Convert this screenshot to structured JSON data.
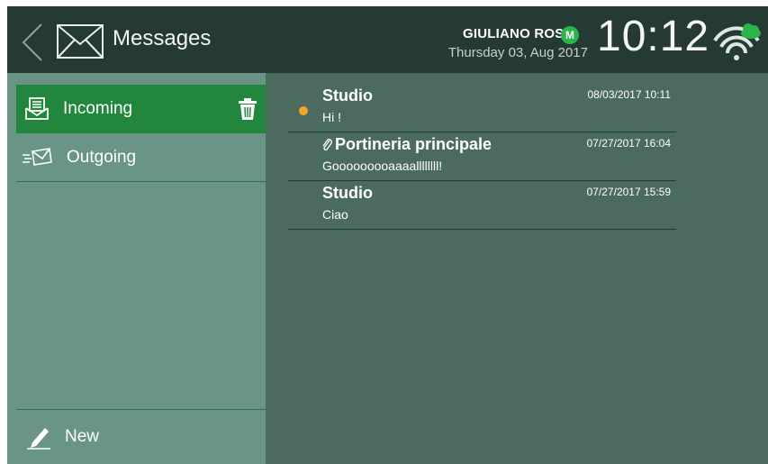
{
  "header": {
    "title": "Messages",
    "user_name": "GIULIANO ROSSI",
    "user_badge": "M",
    "date": "Thursday 03, Aug 2017",
    "time": "10:12",
    "icons": {
      "back": "back-chevron-icon",
      "app": "envelope-icon",
      "network": "wifi-cloud-icon"
    }
  },
  "sidebar": {
    "items": [
      {
        "label": "Incoming",
        "icon": "inbox-icon",
        "selected": true,
        "action_icon": "trash-icon"
      },
      {
        "label": "Outgoing",
        "icon": "send-envelope-icon",
        "selected": false
      }
    ],
    "new_label": "New",
    "new_icon": "pencil-icon"
  },
  "messages": [
    {
      "title": "Studio",
      "body": "Hi !",
      "date": "08/03/2017 10:11",
      "unread": true,
      "attachment": false
    },
    {
      "title": "Portineria principale",
      "body": "Gooooooooaaaallllllll!",
      "date": "07/27/2017 16:04",
      "unread": false,
      "attachment": true
    },
    {
      "title": "Studio",
      "body": "Ciao",
      "date": "07/27/2017 15:59",
      "unread": false,
      "attachment": false
    }
  ],
  "colors": {
    "header_bg": "#253a33",
    "sidebar_bg": "#6a9586",
    "selected_bg": "#22873c",
    "list_bg": "#4b6b5e",
    "unread_dot": "#f6a32a",
    "badge": "#2bb44a",
    "wifi_cloud": "#2bb44a"
  }
}
